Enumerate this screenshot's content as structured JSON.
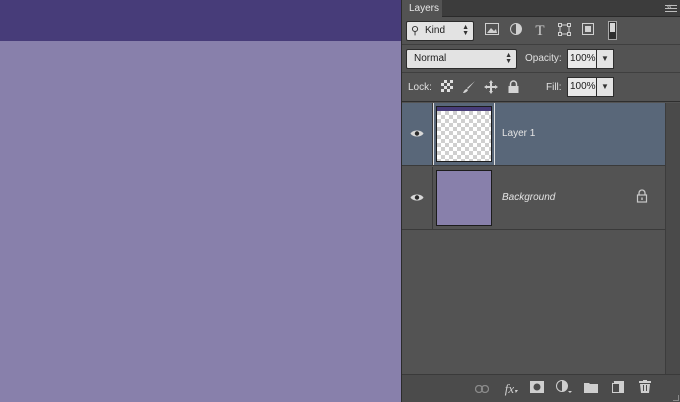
{
  "document": {
    "canvas_color": "#8880ab",
    "top_band_color": "#473c79"
  },
  "panel": {
    "tab_label": "Layers",
    "filter": {
      "kind_label": "Kind",
      "icons": [
        "image-filter-icon",
        "adjustment-filter-icon",
        "type-filter-icon",
        "shape-filter-icon",
        "smart-object-filter-icon"
      ]
    },
    "blend_mode": "Normal",
    "opacity_label": "Opacity:",
    "opacity_value": "100%",
    "lock_label": "Lock:",
    "fill_label": "Fill:",
    "fill_value": "100%"
  },
  "layers": [
    {
      "name": "Layer 1",
      "visible": true,
      "selected": true
    },
    {
      "name": "Background",
      "visible": true,
      "selected": false,
      "locked": true
    }
  ],
  "bottom_bar": {
    "fx_label": "fx",
    "icons": [
      "link-layers-icon",
      "layer-style-icon",
      "add-mask-icon",
      "adjustment-layer-icon",
      "new-group-icon",
      "new-layer-icon",
      "delete-layer-icon"
    ]
  },
  "colors": {
    "selected_layer": "#596779",
    "panel_bg": "#535353"
  }
}
